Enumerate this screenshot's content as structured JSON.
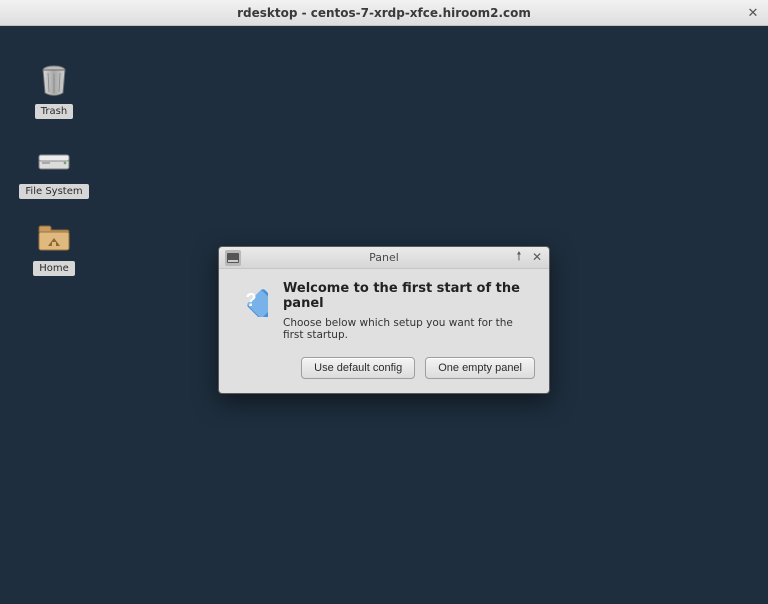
{
  "outerWindow": {
    "title": "rdesktop - centos-7-xrdp-xfce.hiroom2.com"
  },
  "desktopIcons": {
    "trash": {
      "label": "Trash"
    },
    "filesystem": {
      "label": "File System"
    },
    "home": {
      "label": "Home"
    }
  },
  "dialog": {
    "title": "Panel",
    "heading": "Welcome to the first start of the panel",
    "message": "Choose below which setup you want for the first startup.",
    "buttons": {
      "defaultConfig": "Use default config",
      "emptyPanel": "One empty panel"
    }
  }
}
